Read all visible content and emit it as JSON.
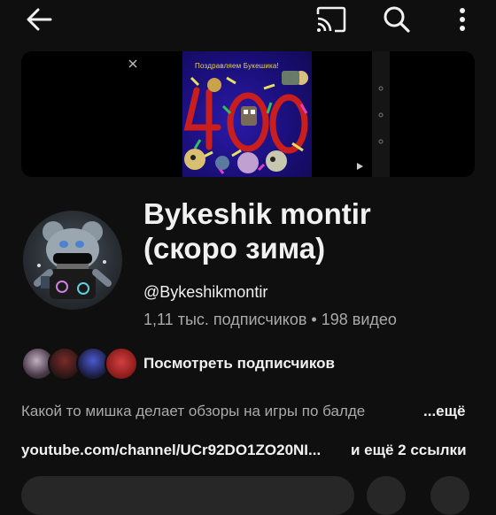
{
  "header": {
    "back_icon": "arrow-left-icon",
    "cast_icon": "cast-icon",
    "search_icon": "search-icon",
    "more_icon": "more-vert-icon"
  },
  "banner": {
    "title_text": "Поздравляем Букешика!"
  },
  "channel": {
    "name_line1": "Bykeshik montir",
    "name_line2": "(скоро зима)",
    "handle": "@Bykeshikmontir",
    "stats": "1,11 тыс. подписчиков • 198 видео"
  },
  "subscribers": {
    "label": "Посмотреть подписчиков"
  },
  "description": {
    "text": "Какой то мишка делает обзоры на игры по балде",
    "more": "...ещё"
  },
  "links": {
    "url": "youtube.com/channel/UCr92DO1ZO20NI...",
    "more": "и ещё 2 ссылки"
  },
  "colors": {
    "background": "#0f0f0f",
    "text_primary": "#f1f1f1",
    "text_secondary": "#aaaaaa",
    "chip": "#272727"
  }
}
